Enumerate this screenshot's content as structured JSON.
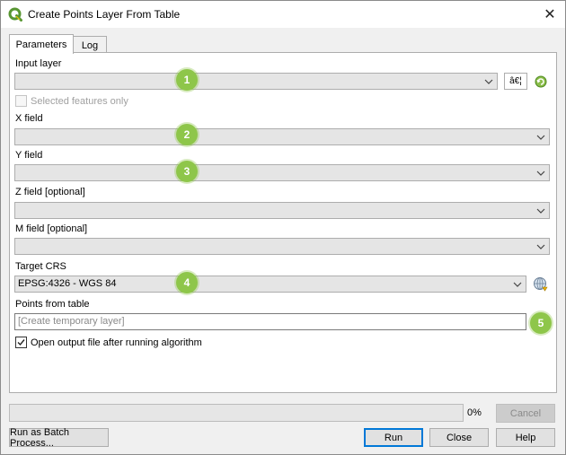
{
  "window": {
    "title": "Create Points Layer From Table",
    "close_glyph": "✕",
    "icon": "qgis-logo-icon"
  },
  "tabs": [
    {
      "label": "Parameters",
      "active": true
    },
    {
      "label": "Log",
      "active": false
    }
  ],
  "params": {
    "input_layer": {
      "label": "Input layer",
      "value": "",
      "ellipsis": "â€¦"
    },
    "selected_only": {
      "label": "Selected features only",
      "checked": false,
      "enabled": false
    },
    "x_field": {
      "label": "X field",
      "value": ""
    },
    "y_field": {
      "label": "Y field",
      "value": ""
    },
    "z_field": {
      "label": "Z field [optional]",
      "value": ""
    },
    "m_field": {
      "label": "M field [optional]",
      "value": ""
    },
    "target_crs": {
      "label": "Target CRS",
      "value": "EPSG:4326 - WGS 84"
    },
    "points_from_table": {
      "label": "Points from table",
      "placeholder": "[Create temporary layer]"
    },
    "open_output": {
      "label": "Open output file after running algorithm",
      "checked": true
    }
  },
  "markers": [
    "1",
    "2",
    "3",
    "4",
    "5"
  ],
  "footer": {
    "progress_percent": 0,
    "progress_text": "0%",
    "cancel_label": "Cancel",
    "batch_label": "Run as Batch Process...",
    "run_label": "Run",
    "close_label": "Close",
    "help_label": "Help"
  },
  "colors": {
    "marker": "#8ec64a",
    "accent": "#0078d7",
    "qgis_green": "#589632"
  }
}
